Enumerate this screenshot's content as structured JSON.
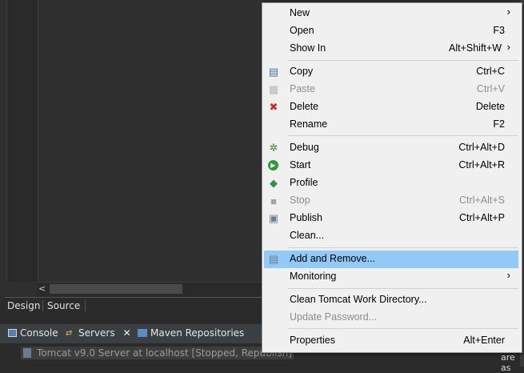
{
  "editor": {
    "design_tab": "Design",
    "source_tab": "Source"
  },
  "views": {
    "console": "Console",
    "servers": "Servers",
    "maven": "Maven Repositories",
    "server_row": "Tomcat v9.0 Server at localhost  [Stopped, Republish]",
    "right_text": "are as"
  },
  "menu": {
    "items": [
      {
        "label": "New",
        "shortcut": "",
        "submenu": true,
        "icon": "",
        "disabled": false
      },
      {
        "label": "Open",
        "shortcut": "F3",
        "icon": "",
        "disabled": false
      },
      {
        "label": "Show In",
        "shortcut": "Alt+Shift+W",
        "submenu": true,
        "icon": "",
        "disabled": false
      },
      {
        "label": "Copy",
        "shortcut": "Ctrl+C",
        "icon": "copy-icon",
        "disabled": false
      },
      {
        "label": "Paste",
        "shortcut": "Ctrl+V",
        "icon": "paste-icon",
        "disabled": true
      },
      {
        "label": "Delete",
        "shortcut": "Delete",
        "icon": "delete-icon",
        "disabled": false
      },
      {
        "label": "Rename",
        "shortcut": "F2",
        "icon": "",
        "disabled": false
      },
      {
        "label": "Debug",
        "shortcut": "Ctrl+Alt+D",
        "icon": "debug-icon",
        "disabled": false
      },
      {
        "label": "Start",
        "shortcut": "Ctrl+Alt+R",
        "icon": "start-icon",
        "disabled": false
      },
      {
        "label": "Profile",
        "shortcut": "",
        "icon": "profile-icon",
        "disabled": false
      },
      {
        "label": "Stop",
        "shortcut": "Ctrl+Alt+S",
        "icon": "stop-icon",
        "disabled": true
      },
      {
        "label": "Publish",
        "shortcut": "Ctrl+Alt+P",
        "icon": "publish-icon",
        "disabled": false
      },
      {
        "label": "Clean...",
        "shortcut": "",
        "icon": "",
        "disabled": false
      },
      {
        "label": "Add and Remove...",
        "shortcut": "",
        "icon": "add-remove-icon",
        "disabled": false,
        "highlighted": true
      },
      {
        "label": "Monitoring",
        "shortcut": "",
        "submenu": true,
        "icon": "",
        "disabled": false
      },
      {
        "label": "Clean Tomcat Work Directory...",
        "shortcut": "",
        "icon": "",
        "disabled": false
      },
      {
        "label": "Update Password...",
        "shortcut": "",
        "icon": "",
        "disabled": true
      },
      {
        "label": "Properties",
        "shortcut": "Alt+Enter",
        "icon": "",
        "disabled": false
      }
    ],
    "highlight_color": "#91c9f7"
  }
}
